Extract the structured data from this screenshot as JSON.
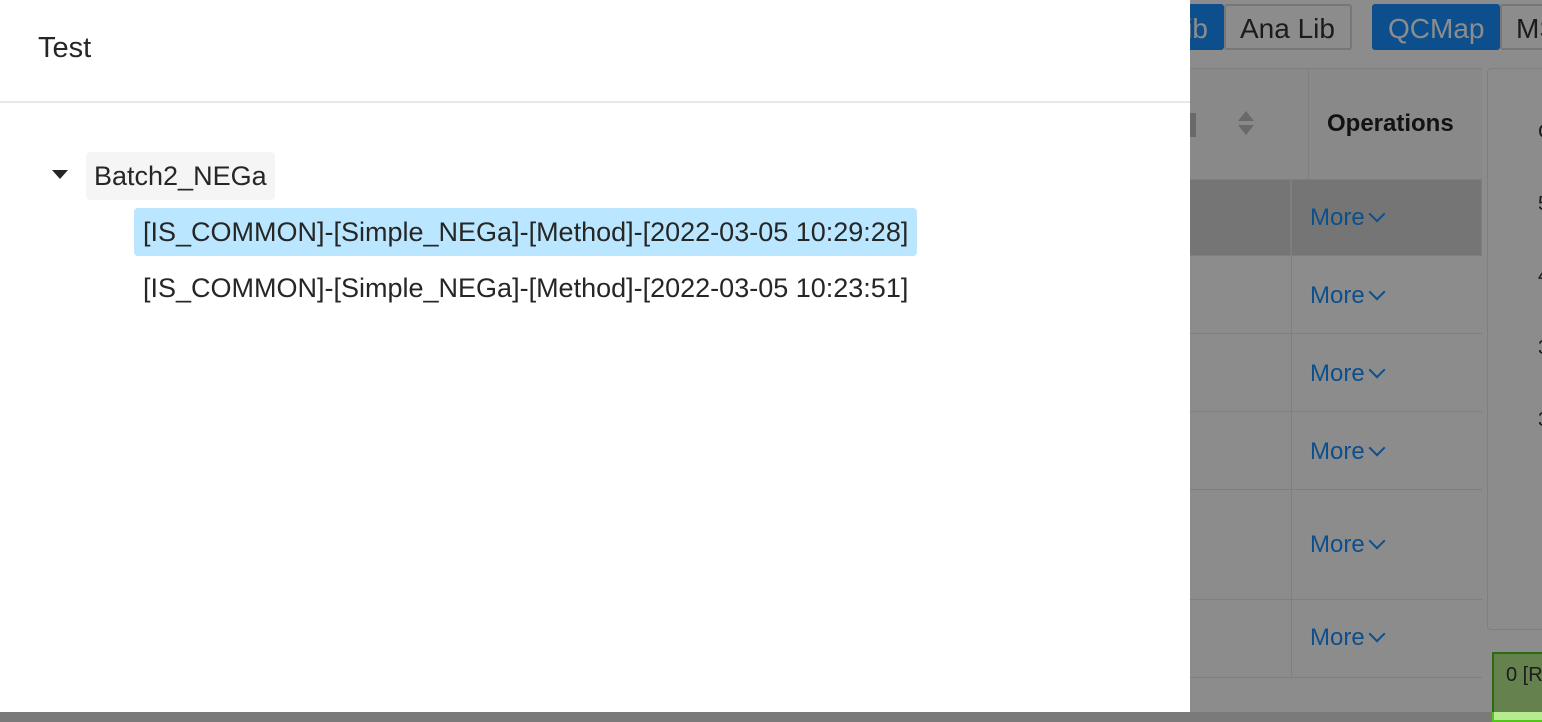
{
  "drawer": {
    "title": "Test",
    "tree": {
      "root": {
        "label": "Batch2_NEGa",
        "expanded": true
      },
      "children": [
        {
          "label": "[IS_COMMON]-[Simple_NEGa]-[Method]-[2022-03-05 10:29:28]",
          "selected": true
        },
        {
          "label": "[IS_COMMON]-[Simple_NEGa]-[Method]-[2022-03-05 10:23:51]",
          "selected": false
        }
      ]
    }
  },
  "background": {
    "top_buttons": [
      {
        "label": "Lib",
        "primary": true
      },
      {
        "label": "Ana Lib",
        "primary": false
      },
      {
        "label": "QCMap",
        "primary": true
      },
      {
        "label": "MS",
        "primary": false
      }
    ],
    "table": {
      "operations_header": "Operations",
      "rows": [
        {
          "more_label": "More",
          "selected": true
        },
        {
          "more_label": "More",
          "selected": false
        },
        {
          "more_label": "More",
          "selected": false
        },
        {
          "more_label": "More",
          "selected": false
        },
        {
          "more_label": "More",
          "selected": false
        },
        {
          "more_label": "More",
          "selected": false
        }
      ]
    },
    "side_panel_glyphs": [
      "C",
      "5",
      "4",
      "3",
      "3"
    ],
    "status_tag": "0 [R"
  },
  "colors": {
    "primary": "#1890ff",
    "tree_selected_bg": "#bae7ff",
    "overlay": "rgba(0,0,0,0.45)"
  }
}
